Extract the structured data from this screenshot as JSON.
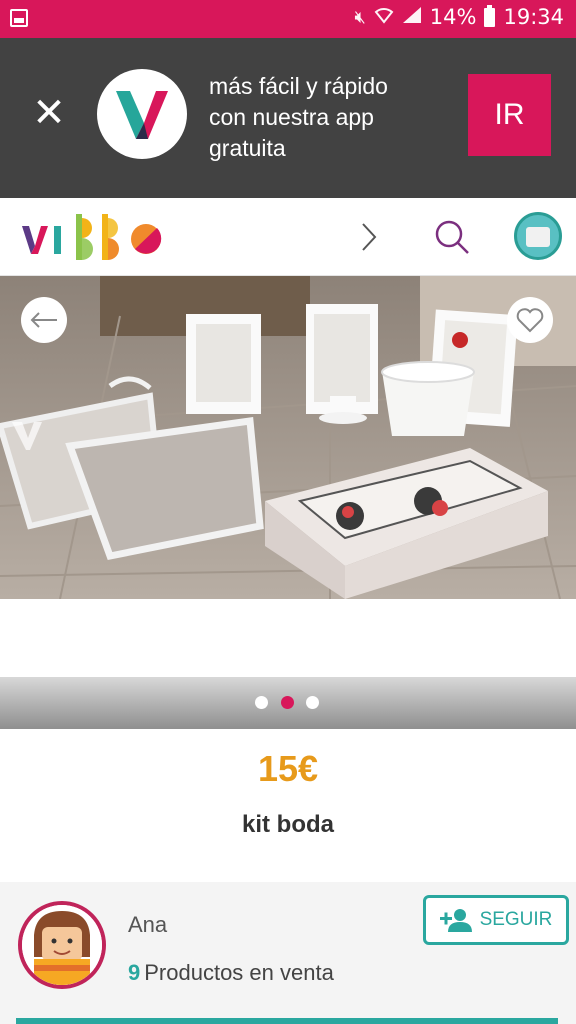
{
  "status_bar": {
    "battery": "14%",
    "time": "19:34",
    "icons": [
      "gallery-icon",
      "mute-icon",
      "wifi-icon",
      "signal-icon",
      "battery-icon"
    ]
  },
  "promo": {
    "close_icon": "close-icon",
    "line1": "más fácil y rápido",
    "line2": "con nuestra app",
    "line3": "gratuita",
    "button": "IR"
  },
  "header": {
    "icons": [
      "chevron-right-icon",
      "search-icon",
      "profile-avatar"
    ]
  },
  "product": {
    "price": "15€",
    "title": "kit boda",
    "carousel": {
      "count": 3,
      "active": 2
    }
  },
  "seller": {
    "name": "Ana",
    "products_count": "9",
    "products_label": "Productos en venta",
    "follow_label": "SEGUIR"
  },
  "colors": {
    "brand": "#d8175a",
    "teal": "#2aa79f",
    "price": "#e79a1b",
    "promo_bg": "#424242"
  }
}
